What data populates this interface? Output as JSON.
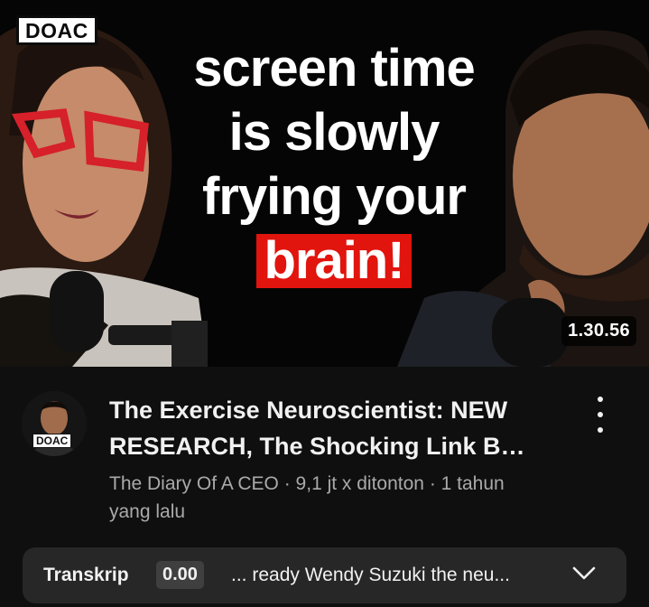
{
  "thumbnail": {
    "channel_logo": "DOAC",
    "headline": [
      "screen time",
      "is slowly",
      "frying your"
    ],
    "headline_highlight": "brain!",
    "highlight_color": "#e1140e",
    "duration": "1.30.56"
  },
  "video": {
    "avatar_badge": "DOAC",
    "title_lines": [
      "The Exercise Neuroscientist: NEW",
      "RESEARCH, The Shocking Link B…"
    ],
    "meta_line1": "The Diary Of A CEO · 9,1 jt x ditonton · 1 tahun",
    "meta_line2": "yang lalu",
    "more_icon": "vertical-dots-icon"
  },
  "transcript": {
    "label": "Transkrip",
    "timestamp": "0.00",
    "snippet": "... ready Wendy Suzuki the neu...",
    "expand_icon": "chevron-down-icon"
  }
}
